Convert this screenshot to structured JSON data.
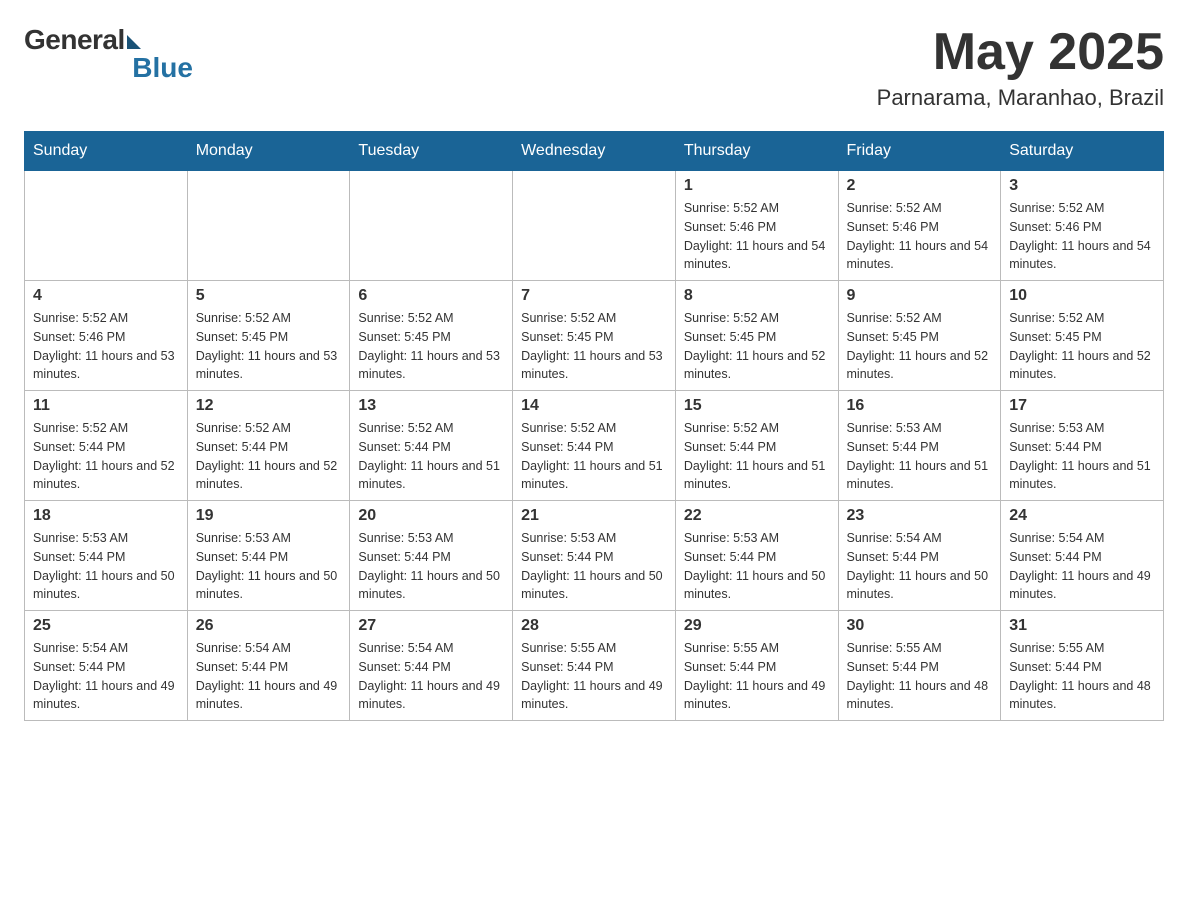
{
  "header": {
    "logo": {
      "general": "General",
      "blue": "Blue"
    },
    "title": "May 2025",
    "location": "Parnarama, Maranhao, Brazil"
  },
  "days_of_week": [
    "Sunday",
    "Monday",
    "Tuesday",
    "Wednesday",
    "Thursday",
    "Friday",
    "Saturday"
  ],
  "weeks": [
    [
      {
        "day": "",
        "sunrise": "",
        "sunset": "",
        "daylight": ""
      },
      {
        "day": "",
        "sunrise": "",
        "sunset": "",
        "daylight": ""
      },
      {
        "day": "",
        "sunrise": "",
        "sunset": "",
        "daylight": ""
      },
      {
        "day": "",
        "sunrise": "",
        "sunset": "",
        "daylight": ""
      },
      {
        "day": "1",
        "sunrise": "Sunrise: 5:52 AM",
        "sunset": "Sunset: 5:46 PM",
        "daylight": "Daylight: 11 hours and 54 minutes."
      },
      {
        "day": "2",
        "sunrise": "Sunrise: 5:52 AM",
        "sunset": "Sunset: 5:46 PM",
        "daylight": "Daylight: 11 hours and 54 minutes."
      },
      {
        "day": "3",
        "sunrise": "Sunrise: 5:52 AM",
        "sunset": "Sunset: 5:46 PM",
        "daylight": "Daylight: 11 hours and 54 minutes."
      }
    ],
    [
      {
        "day": "4",
        "sunrise": "Sunrise: 5:52 AM",
        "sunset": "Sunset: 5:46 PM",
        "daylight": "Daylight: 11 hours and 53 minutes."
      },
      {
        "day": "5",
        "sunrise": "Sunrise: 5:52 AM",
        "sunset": "Sunset: 5:45 PM",
        "daylight": "Daylight: 11 hours and 53 minutes."
      },
      {
        "day": "6",
        "sunrise": "Sunrise: 5:52 AM",
        "sunset": "Sunset: 5:45 PM",
        "daylight": "Daylight: 11 hours and 53 minutes."
      },
      {
        "day": "7",
        "sunrise": "Sunrise: 5:52 AM",
        "sunset": "Sunset: 5:45 PM",
        "daylight": "Daylight: 11 hours and 53 minutes."
      },
      {
        "day": "8",
        "sunrise": "Sunrise: 5:52 AM",
        "sunset": "Sunset: 5:45 PM",
        "daylight": "Daylight: 11 hours and 52 minutes."
      },
      {
        "day": "9",
        "sunrise": "Sunrise: 5:52 AM",
        "sunset": "Sunset: 5:45 PM",
        "daylight": "Daylight: 11 hours and 52 minutes."
      },
      {
        "day": "10",
        "sunrise": "Sunrise: 5:52 AM",
        "sunset": "Sunset: 5:45 PM",
        "daylight": "Daylight: 11 hours and 52 minutes."
      }
    ],
    [
      {
        "day": "11",
        "sunrise": "Sunrise: 5:52 AM",
        "sunset": "Sunset: 5:44 PM",
        "daylight": "Daylight: 11 hours and 52 minutes."
      },
      {
        "day": "12",
        "sunrise": "Sunrise: 5:52 AM",
        "sunset": "Sunset: 5:44 PM",
        "daylight": "Daylight: 11 hours and 52 minutes."
      },
      {
        "day": "13",
        "sunrise": "Sunrise: 5:52 AM",
        "sunset": "Sunset: 5:44 PM",
        "daylight": "Daylight: 11 hours and 51 minutes."
      },
      {
        "day": "14",
        "sunrise": "Sunrise: 5:52 AM",
        "sunset": "Sunset: 5:44 PM",
        "daylight": "Daylight: 11 hours and 51 minutes."
      },
      {
        "day": "15",
        "sunrise": "Sunrise: 5:52 AM",
        "sunset": "Sunset: 5:44 PM",
        "daylight": "Daylight: 11 hours and 51 minutes."
      },
      {
        "day": "16",
        "sunrise": "Sunrise: 5:53 AM",
        "sunset": "Sunset: 5:44 PM",
        "daylight": "Daylight: 11 hours and 51 minutes."
      },
      {
        "day": "17",
        "sunrise": "Sunrise: 5:53 AM",
        "sunset": "Sunset: 5:44 PM",
        "daylight": "Daylight: 11 hours and 51 minutes."
      }
    ],
    [
      {
        "day": "18",
        "sunrise": "Sunrise: 5:53 AM",
        "sunset": "Sunset: 5:44 PM",
        "daylight": "Daylight: 11 hours and 50 minutes."
      },
      {
        "day": "19",
        "sunrise": "Sunrise: 5:53 AM",
        "sunset": "Sunset: 5:44 PM",
        "daylight": "Daylight: 11 hours and 50 minutes."
      },
      {
        "day": "20",
        "sunrise": "Sunrise: 5:53 AM",
        "sunset": "Sunset: 5:44 PM",
        "daylight": "Daylight: 11 hours and 50 minutes."
      },
      {
        "day": "21",
        "sunrise": "Sunrise: 5:53 AM",
        "sunset": "Sunset: 5:44 PM",
        "daylight": "Daylight: 11 hours and 50 minutes."
      },
      {
        "day": "22",
        "sunrise": "Sunrise: 5:53 AM",
        "sunset": "Sunset: 5:44 PM",
        "daylight": "Daylight: 11 hours and 50 minutes."
      },
      {
        "day": "23",
        "sunrise": "Sunrise: 5:54 AM",
        "sunset": "Sunset: 5:44 PM",
        "daylight": "Daylight: 11 hours and 50 minutes."
      },
      {
        "day": "24",
        "sunrise": "Sunrise: 5:54 AM",
        "sunset": "Sunset: 5:44 PM",
        "daylight": "Daylight: 11 hours and 49 minutes."
      }
    ],
    [
      {
        "day": "25",
        "sunrise": "Sunrise: 5:54 AM",
        "sunset": "Sunset: 5:44 PM",
        "daylight": "Daylight: 11 hours and 49 minutes."
      },
      {
        "day": "26",
        "sunrise": "Sunrise: 5:54 AM",
        "sunset": "Sunset: 5:44 PM",
        "daylight": "Daylight: 11 hours and 49 minutes."
      },
      {
        "day": "27",
        "sunrise": "Sunrise: 5:54 AM",
        "sunset": "Sunset: 5:44 PM",
        "daylight": "Daylight: 11 hours and 49 minutes."
      },
      {
        "day": "28",
        "sunrise": "Sunrise: 5:55 AM",
        "sunset": "Sunset: 5:44 PM",
        "daylight": "Daylight: 11 hours and 49 minutes."
      },
      {
        "day": "29",
        "sunrise": "Sunrise: 5:55 AM",
        "sunset": "Sunset: 5:44 PM",
        "daylight": "Daylight: 11 hours and 49 minutes."
      },
      {
        "day": "30",
        "sunrise": "Sunrise: 5:55 AM",
        "sunset": "Sunset: 5:44 PM",
        "daylight": "Daylight: 11 hours and 48 minutes."
      },
      {
        "day": "31",
        "sunrise": "Sunrise: 5:55 AM",
        "sunset": "Sunset: 5:44 PM",
        "daylight": "Daylight: 11 hours and 48 minutes."
      }
    ]
  ]
}
